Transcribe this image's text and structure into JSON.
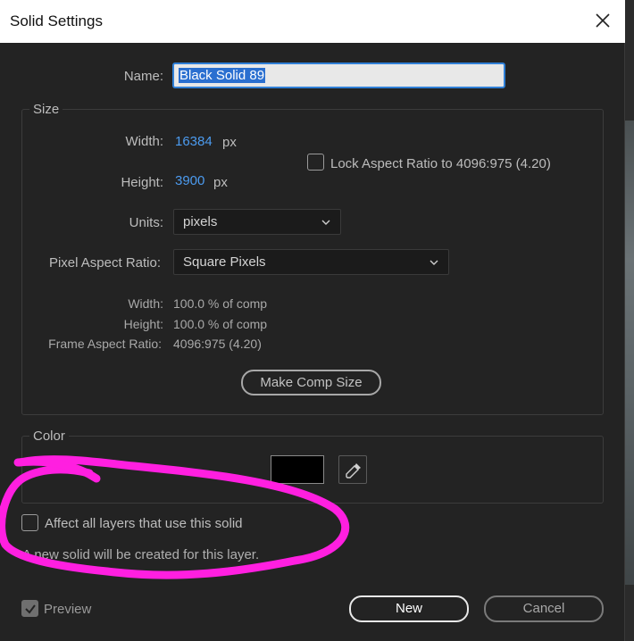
{
  "window": {
    "title": "Solid Settings"
  },
  "name": {
    "label": "Name:",
    "value": "Black Solid 89"
  },
  "size": {
    "group_title": "Size",
    "width_label": "Width:",
    "width_value": "16384",
    "height_label": "Height:",
    "height_value": "3900",
    "unit": "px",
    "lock_label": "Lock Aspect Ratio to 4096:975 (4.20)",
    "lock_checked": false,
    "units_label": "Units:",
    "units_value": "pixels",
    "par_label": "Pixel Aspect Ratio:",
    "par_value": "Square Pixels",
    "info_width_label": "Width:",
    "info_width_value": "100.0 % of comp",
    "info_height_label": "Height:",
    "info_height_value": "100.0 % of comp",
    "info_far_label": "Frame Aspect Ratio:",
    "info_far_value": "4096:975 (4.20)",
    "make_comp_size": "Make Comp Size"
  },
  "color": {
    "group_title": "Color",
    "swatch_color": "#000000"
  },
  "affect": {
    "label": "Affect all layers that use this solid",
    "checked": false
  },
  "note": "A new solid will be created for this layer.",
  "footer": {
    "preview_label": "Preview",
    "preview_checked": true,
    "new_label": "New",
    "cancel_label": "Cancel"
  },
  "icons": {
    "close": "close-icon",
    "chevron": "chevron-down-icon",
    "eyedropper": "eyedropper-icon",
    "check": "checkmark-icon"
  },
  "colors": {
    "annotation": "#ff1fe0",
    "accent_blue": "#4c9bef",
    "selection": "#2a6fd0"
  }
}
